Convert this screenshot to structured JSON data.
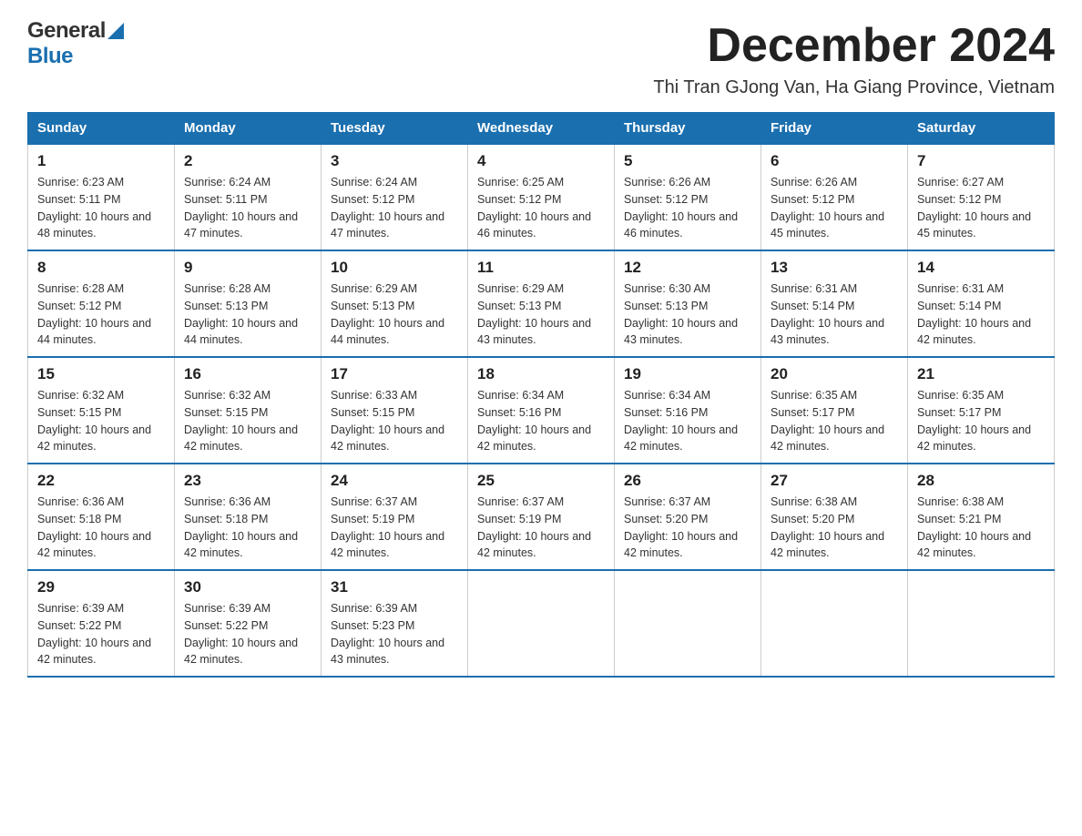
{
  "logo": {
    "text_general": "General",
    "text_blue": "Blue",
    "aria": "GeneralBlue logo"
  },
  "header": {
    "month_year": "December 2024",
    "location": "Thi Tran GJong Van, Ha Giang Province, Vietnam"
  },
  "weekdays": [
    "Sunday",
    "Monday",
    "Tuesday",
    "Wednesday",
    "Thursday",
    "Friday",
    "Saturday"
  ],
  "weeks": [
    [
      {
        "day": "1",
        "sunrise": "6:23 AM",
        "sunset": "5:11 PM",
        "daylight": "10 hours and 48 minutes."
      },
      {
        "day": "2",
        "sunrise": "6:24 AM",
        "sunset": "5:11 PM",
        "daylight": "10 hours and 47 minutes."
      },
      {
        "day": "3",
        "sunrise": "6:24 AM",
        "sunset": "5:12 PM",
        "daylight": "10 hours and 47 minutes."
      },
      {
        "day": "4",
        "sunrise": "6:25 AM",
        "sunset": "5:12 PM",
        "daylight": "10 hours and 46 minutes."
      },
      {
        "day": "5",
        "sunrise": "6:26 AM",
        "sunset": "5:12 PM",
        "daylight": "10 hours and 46 minutes."
      },
      {
        "day": "6",
        "sunrise": "6:26 AM",
        "sunset": "5:12 PM",
        "daylight": "10 hours and 45 minutes."
      },
      {
        "day": "7",
        "sunrise": "6:27 AM",
        "sunset": "5:12 PM",
        "daylight": "10 hours and 45 minutes."
      }
    ],
    [
      {
        "day": "8",
        "sunrise": "6:28 AM",
        "sunset": "5:12 PM",
        "daylight": "10 hours and 44 minutes."
      },
      {
        "day": "9",
        "sunrise": "6:28 AM",
        "sunset": "5:13 PM",
        "daylight": "10 hours and 44 minutes."
      },
      {
        "day": "10",
        "sunrise": "6:29 AM",
        "sunset": "5:13 PM",
        "daylight": "10 hours and 44 minutes."
      },
      {
        "day": "11",
        "sunrise": "6:29 AM",
        "sunset": "5:13 PM",
        "daylight": "10 hours and 43 minutes."
      },
      {
        "day": "12",
        "sunrise": "6:30 AM",
        "sunset": "5:13 PM",
        "daylight": "10 hours and 43 minutes."
      },
      {
        "day": "13",
        "sunrise": "6:31 AM",
        "sunset": "5:14 PM",
        "daylight": "10 hours and 43 minutes."
      },
      {
        "day": "14",
        "sunrise": "6:31 AM",
        "sunset": "5:14 PM",
        "daylight": "10 hours and 42 minutes."
      }
    ],
    [
      {
        "day": "15",
        "sunrise": "6:32 AM",
        "sunset": "5:15 PM",
        "daylight": "10 hours and 42 minutes."
      },
      {
        "day": "16",
        "sunrise": "6:32 AM",
        "sunset": "5:15 PM",
        "daylight": "10 hours and 42 minutes."
      },
      {
        "day": "17",
        "sunrise": "6:33 AM",
        "sunset": "5:15 PM",
        "daylight": "10 hours and 42 minutes."
      },
      {
        "day": "18",
        "sunrise": "6:34 AM",
        "sunset": "5:16 PM",
        "daylight": "10 hours and 42 minutes."
      },
      {
        "day": "19",
        "sunrise": "6:34 AM",
        "sunset": "5:16 PM",
        "daylight": "10 hours and 42 minutes."
      },
      {
        "day": "20",
        "sunrise": "6:35 AM",
        "sunset": "5:17 PM",
        "daylight": "10 hours and 42 minutes."
      },
      {
        "day": "21",
        "sunrise": "6:35 AM",
        "sunset": "5:17 PM",
        "daylight": "10 hours and 42 minutes."
      }
    ],
    [
      {
        "day": "22",
        "sunrise": "6:36 AM",
        "sunset": "5:18 PM",
        "daylight": "10 hours and 42 minutes."
      },
      {
        "day": "23",
        "sunrise": "6:36 AM",
        "sunset": "5:18 PM",
        "daylight": "10 hours and 42 minutes."
      },
      {
        "day": "24",
        "sunrise": "6:37 AM",
        "sunset": "5:19 PM",
        "daylight": "10 hours and 42 minutes."
      },
      {
        "day": "25",
        "sunrise": "6:37 AM",
        "sunset": "5:19 PM",
        "daylight": "10 hours and 42 minutes."
      },
      {
        "day": "26",
        "sunrise": "6:37 AM",
        "sunset": "5:20 PM",
        "daylight": "10 hours and 42 minutes."
      },
      {
        "day": "27",
        "sunrise": "6:38 AM",
        "sunset": "5:20 PM",
        "daylight": "10 hours and 42 minutes."
      },
      {
        "day": "28",
        "sunrise": "6:38 AM",
        "sunset": "5:21 PM",
        "daylight": "10 hours and 42 minutes."
      }
    ],
    [
      {
        "day": "29",
        "sunrise": "6:39 AM",
        "sunset": "5:22 PM",
        "daylight": "10 hours and 42 minutes."
      },
      {
        "day": "30",
        "sunrise": "6:39 AM",
        "sunset": "5:22 PM",
        "daylight": "10 hours and 42 minutes."
      },
      {
        "day": "31",
        "sunrise": "6:39 AM",
        "sunset": "5:23 PM",
        "daylight": "10 hours and 43 minutes."
      },
      null,
      null,
      null,
      null
    ]
  ],
  "labels": {
    "sunrise": "Sunrise:",
    "sunset": "Sunset:",
    "daylight": "Daylight:"
  }
}
